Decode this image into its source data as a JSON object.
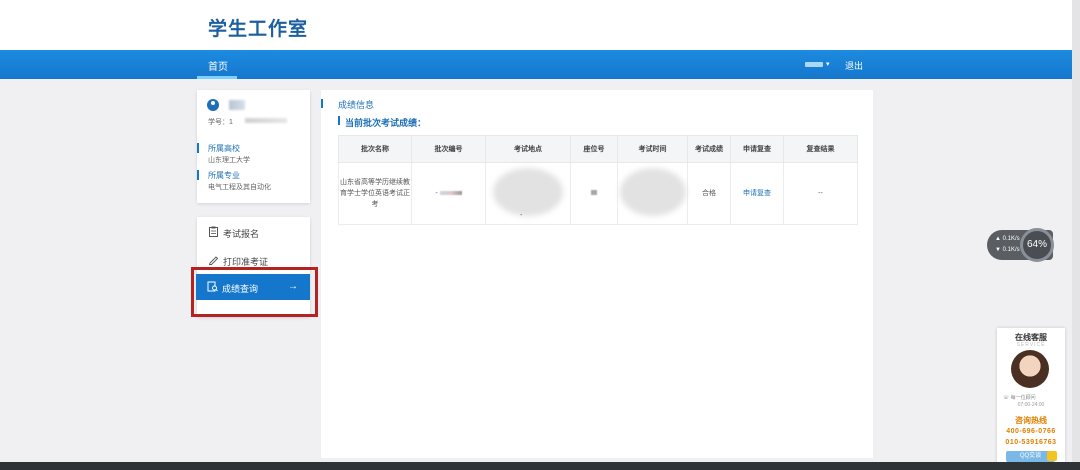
{
  "site": {
    "title": "学生工作室"
  },
  "nav": {
    "home": "首页",
    "logout": "退出",
    "caret": "▾"
  },
  "profile": {
    "student_id_label": "学号：1",
    "school_label": "所属高校",
    "school_value": "山东理工大学",
    "major_label": "所属专业",
    "major_value": "电气工程及其自动化"
  },
  "menu": {
    "items": [
      {
        "label": "考试报名",
        "icon": "clipboard-icon"
      },
      {
        "label": "打印准考证",
        "icon": "pencil-icon"
      },
      {
        "label": "成绩查询",
        "icon": "book-search-icon"
      }
    ],
    "active_arrow": "→"
  },
  "main": {
    "section_title": "成绩信息",
    "subsection_title": "当前批次考试成绩："
  },
  "table": {
    "headers": [
      "批次名称",
      "批次编号",
      "考试地点",
      "座位号",
      "考试时间",
      "考试成绩",
      "申请复查",
      "复查结果"
    ],
    "row": {
      "batch_name": "山东省高等学历继续教育学士学位英语考试正考",
      "batch_no_prefix": "-",
      "exam_location_dash": "-",
      "score": "合格",
      "review_link": "申请复查",
      "review_result": "--"
    }
  },
  "widgets": {
    "speed_up": "▲ 0.1K/s",
    "speed_down": "▼ 0.1K/s",
    "cpu_percent": "64%"
  },
  "customer_service": {
    "title": "在线客服",
    "subtitle": "SERVICE",
    "phone_label": "每一位顾问",
    "hours": "07:00-24:00",
    "hotline_label": "咨询热线",
    "numbers": [
      "400-696-0766",
      "010-53916763"
    ],
    "qq_button": "QQ交谈"
  },
  "colors": {
    "primary": "#1577cc",
    "accent_orange": "#e08000",
    "highlight_border": "#b42222"
  }
}
